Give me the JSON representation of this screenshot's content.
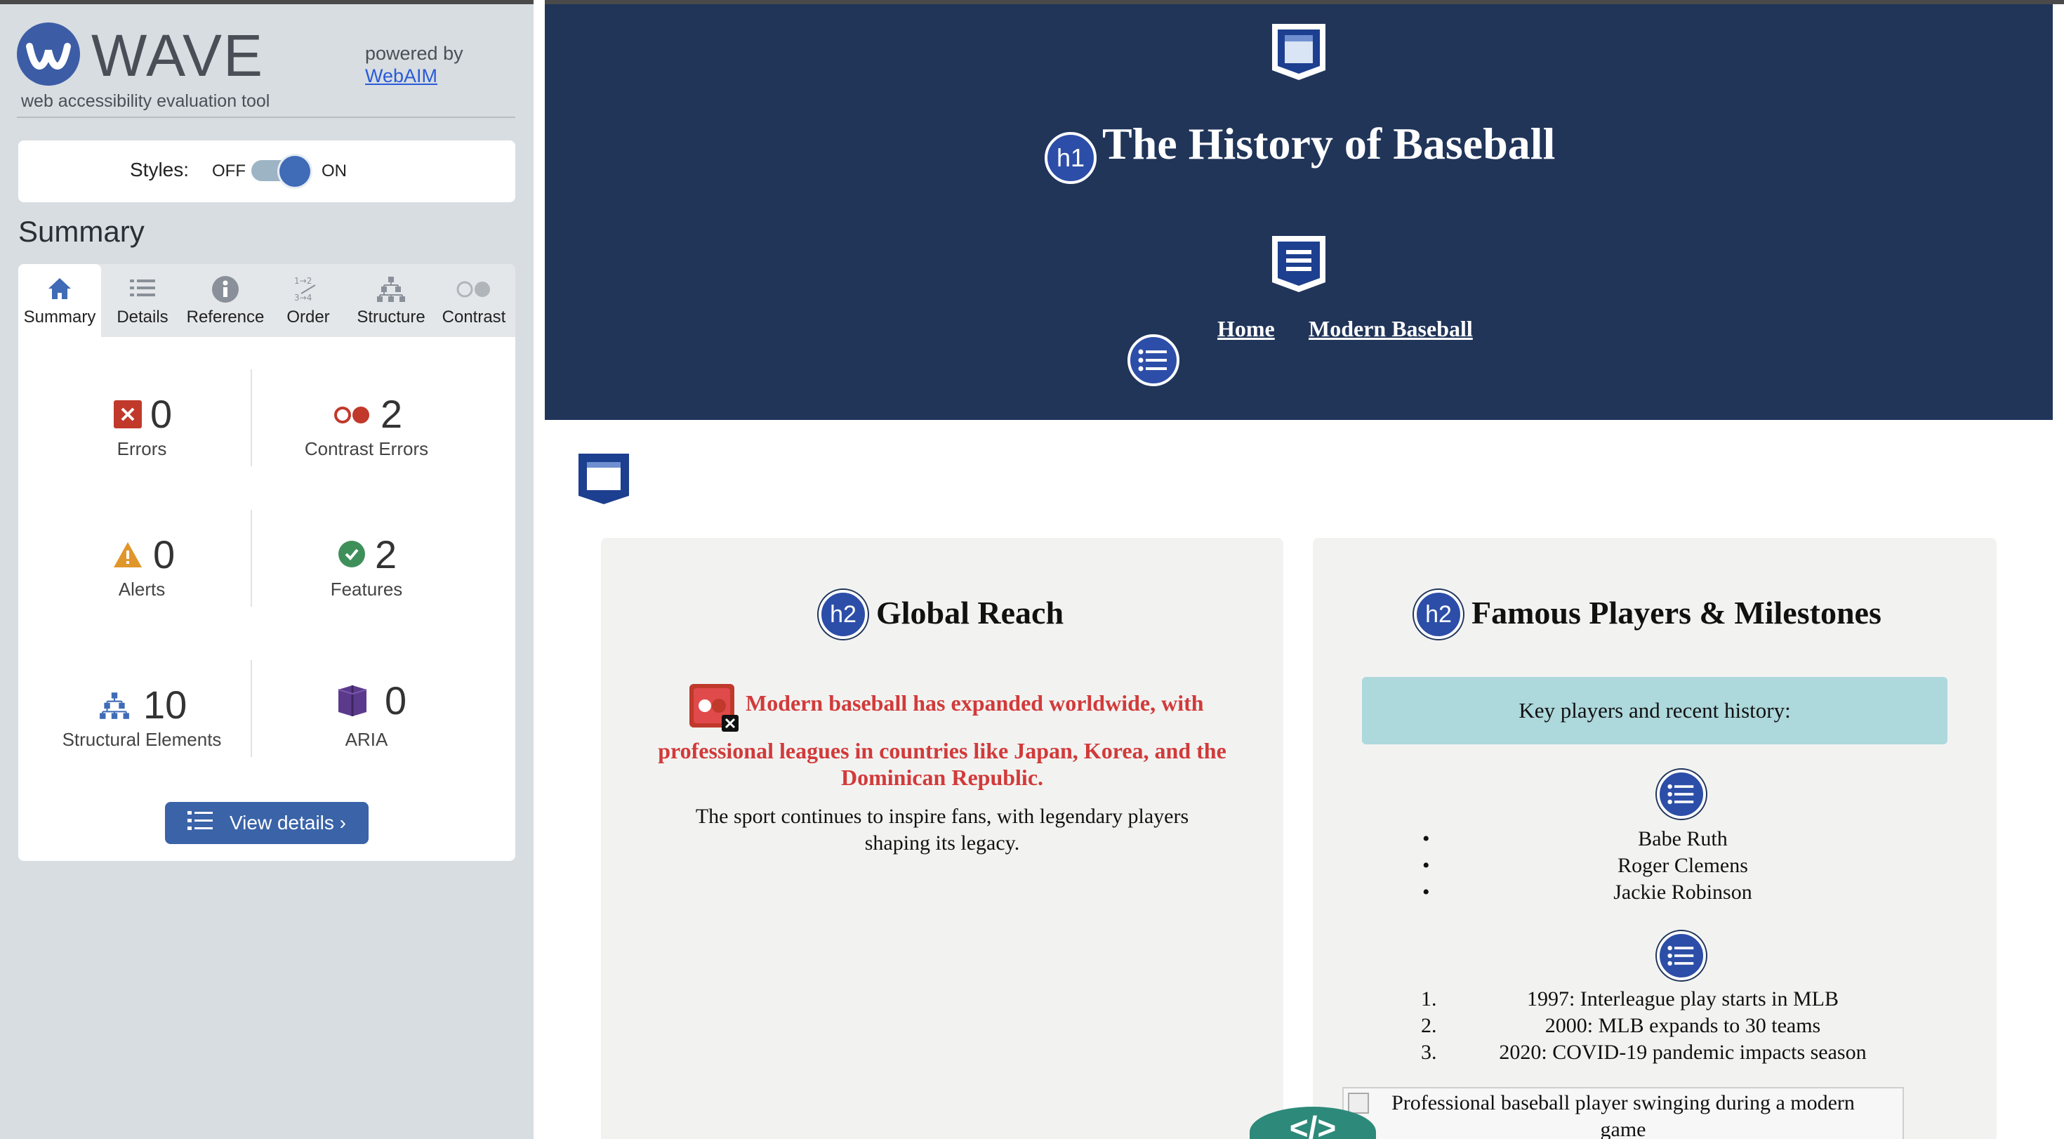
{
  "wave": {
    "logo_text": "WAVE",
    "subtitle": "web accessibility evaluation tool",
    "powered_by": "powered by",
    "webaim_link": "WebAIM",
    "styles_label": "Styles:",
    "styles_off": "OFF",
    "styles_on": "ON",
    "styles_state": "on",
    "summary_heading": "Summary",
    "tabs": [
      {
        "label": "Summary",
        "icon": "home-icon",
        "active": true
      },
      {
        "label": "Details",
        "icon": "details-list-icon",
        "active": false
      },
      {
        "label": "Reference",
        "icon": "info-icon",
        "active": false
      },
      {
        "label": "Order",
        "icon": "order-icon",
        "active": false
      },
      {
        "label": "Structure",
        "icon": "structure-icon",
        "active": false
      },
      {
        "label": "Contrast",
        "icon": "contrast-icon",
        "active": false
      }
    ],
    "stats": {
      "errors": {
        "count": "0",
        "label": "Errors"
      },
      "contrast_errors": {
        "count": "2",
        "label": "Contrast Errors"
      },
      "alerts": {
        "count": "0",
        "label": "Alerts"
      },
      "features": {
        "count": "2",
        "label": "Features"
      },
      "structural": {
        "count": "10",
        "label": "Structural Elements"
      },
      "aria": {
        "count": "0",
        "label": "ARIA"
      }
    },
    "view_details": "View details ›",
    "colors": {
      "accent": "#3a63a8",
      "error": "#c0392b",
      "alert": "#e0962a",
      "feature": "#3f8f5b",
      "aria": "#5b3a8c"
    }
  },
  "page": {
    "title": "The History of Baseball",
    "h1_badge": "h1",
    "nav": [
      "Home",
      "Modern Baseball"
    ],
    "cards": {
      "global": {
        "badge": "h2",
        "title": "Global Reach",
        "red_line1": "Modern baseball has expanded worldwide, with",
        "red_line2": "professional leagues in countries like Japan, Korea, and the",
        "red_line3": "Dominican Republic.",
        "body_line1": "The sport continues to inspire fans, with legendary players",
        "body_line2": "shaping its legacy."
      },
      "famous": {
        "badge": "h2",
        "title": "Famous Players & Milestones",
        "key_box": "Key players and recent history:",
        "players": [
          "Babe Ruth",
          "Roger Clemens",
          "Jackie Robinson"
        ],
        "milestones": [
          "1997: Interleague play starts in MLB",
          "2000: MLB expands to 30 teams",
          "2020: COVID-19 pandemic impacts season"
        ],
        "image_alt_line1": "Professional baseball player swinging during a modern",
        "image_alt_line2": "game"
      }
    },
    "code_tab": "</>",
    "colors": {
      "header_bg": "#213559",
      "card_bg": "#f2f3f1",
      "key_box": "#add8dc",
      "contrast_error_text": "#d23a3a"
    }
  }
}
